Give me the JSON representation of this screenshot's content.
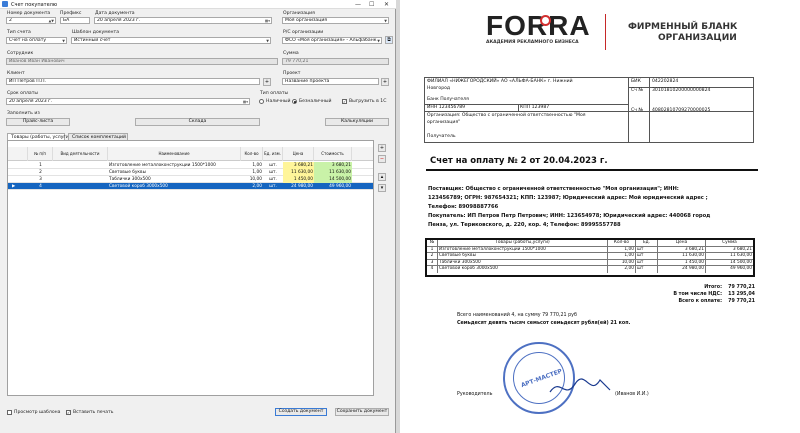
{
  "window": {
    "title": "Счет покупателю",
    "controls": [
      "—",
      "☐",
      "✕"
    ]
  },
  "form": {
    "doc_number_label": "Номер документа",
    "doc_number_value": "2",
    "prefix_label": "Префикс",
    "prefix_value": "БА",
    "doc_date_label": "Дата документа",
    "doc_date_value": "20  апреля  2023 г.",
    "org_label": "Организация",
    "org_value": "Моя организация",
    "account_type_label": "Тип счета",
    "account_type_value": "Счет на оплату",
    "template_label": "Шаблон документа",
    "template_value": "Истинный счет",
    "bank_account_label": "Р/С организации",
    "bank_account_value": "ФСО «Моя организация» - Альфабанк",
    "employee_label": "Сотрудник",
    "employee_value": "Иванов Иван Иванович",
    "sum_label": "Сумма",
    "sum_value": "79 770,21",
    "client_label": "Клиент",
    "client_value": "ИП Петров П.П.",
    "project_label": "Проект",
    "project_value": "Название проекта",
    "pay_term_label": "Срок оплаты",
    "pay_term_value": "20  апреля  2023 г.",
    "pay_type_label": "Тип оплаты",
    "pay_type_cash": "Наличный",
    "pay_type_noncash": "Безналичный",
    "upload_1c_label": "Выгрузить в 1С",
    "fill_from_label": "Заполнить из",
    "btn_price": "Прайс-листа",
    "btn_warehouse": "Склада",
    "btn_calc": "Калькуляции",
    "tab_goods": "Товары (работы, услуги)",
    "tab_packaging": "Список комплектаций",
    "preview_label": "Просмотр шаблона",
    "print_label": "Вставить печать",
    "btn_create": "Создать документ",
    "btn_save": "Сохранить документ"
  },
  "grid": {
    "headers": [
      "№ п/п",
      "Вид деятельности",
      "Наименование",
      "Кол-во",
      "Ед. изм.",
      "Цена",
      "Стоимость"
    ],
    "rows": [
      {
        "n": "1",
        "name": "Изготовление металлоконструкции 1500*1000",
        "qty": "1,00",
        "unit": "шт.",
        "price": "3 680,21",
        "cost": "3 680,21"
      },
      {
        "n": "2",
        "name": "Световые буквы",
        "qty": "1,00",
        "unit": "шт.",
        "price": "11 630,00",
        "cost": "11 630,00"
      },
      {
        "n": "3",
        "name": "Таблички 300х500",
        "qty": "10,00",
        "unit": "шт.",
        "price": "1 450,00",
        "cost": "14 500,00"
      },
      {
        "n": "4",
        "name": "Световой короб 3000х500",
        "qty": "2,00",
        "unit": "шт.",
        "price": "24 980,00",
        "cost": "49 960,00"
      }
    ]
  },
  "document": {
    "logo_text": "FORRA",
    "logo_sub": "АКАДЕМИЯ РЕКЛАМНОГО БИЗНЕСА",
    "blank_title_1": "ФИРМЕННЫЙ БЛАНК",
    "blank_title_2": "ОРГАНИЗАЦИИ",
    "bank_name_1": "ФИЛИАЛ «НИЖЕГОРОДСКИЙ» АО «АЛЬФА-БАНК» г. Нижний",
    "bank_name_2": "Новгород",
    "bik_label": "БИК",
    "bik_value": "042202824",
    "corr_label": "Сч №",
    "corr_value": "30101810200000000824",
    "recipient_bank_label": "Банк Получателя",
    "inn_label": "ИНН 123456789",
    "kpp_label": "КПП 123987",
    "acct_label": "Сч №",
    "acct_value": "40802810709270000025",
    "org_line_1": "Организация: Общество с ограниченной ответственностью \"Моя",
    "org_line_2": "организация\"",
    "recipient_label": "Получатель",
    "invoice_title": "Счет на оплату № 2 от 20.04.2023 г.",
    "supplier_1": "Поставщик:  Общество  с  ограниченной  ответственностью  \"Моя  организация\";  ИНН:",
    "supplier_2": "123456789;  ОГРН:  987654321;  КПП:  123987;  Юридический  адрес:  Мой  юридический  адрес ;",
    "supplier_3": "Телефон: 89098887766",
    "buyer_1": "Покупатель: ИП Петров Петр Петрович; ИНН: 123654978; Юридический адрес: 440068 город",
    "buyer_2": "Пенза, ул. Териковского, д. 220, кор. 4; Телефон: 89995557788",
    "table_headers": [
      "№",
      "Товары (работы,услуги)",
      "Кол-во",
      "Ед.",
      "Цена",
      "Сумма"
    ],
    "table_rows": [
      [
        "1",
        "Изготовление металлоконструкции 1500*1000",
        "1,00",
        "шт",
        "3 680,21",
        "3 680,21"
      ],
      [
        "2",
        "Световые буквы",
        "1,00",
        "шт",
        "11 630,00",
        "11 630,00"
      ],
      [
        "3",
        "Таблички 300х500",
        "10,00",
        "шт",
        "1 450,00",
        "14 500,00"
      ],
      [
        "4",
        "Световой короб 3000х500",
        "2,00",
        "шт",
        "24 980,00",
        "49 960,00"
      ]
    ],
    "total_label": "Итого:",
    "total_value": "79 770,21",
    "vat_label": "В том числе НДС:",
    "vat_value": "13 295,04",
    "topay_label": "Всего к оплате:",
    "topay_value": "79 770,21",
    "summary_1": "Всего наименований 4, на сумму 79 770,21 руб",
    "summary_2": "Семьдесят девять тысяч семьсот семьдесят  рубля(ей) 21 коп.",
    "signer_label": "Руководитель",
    "signer_name": "(Иванов И.И.)",
    "stamp_text": "АРТ-МАСТЕР"
  }
}
